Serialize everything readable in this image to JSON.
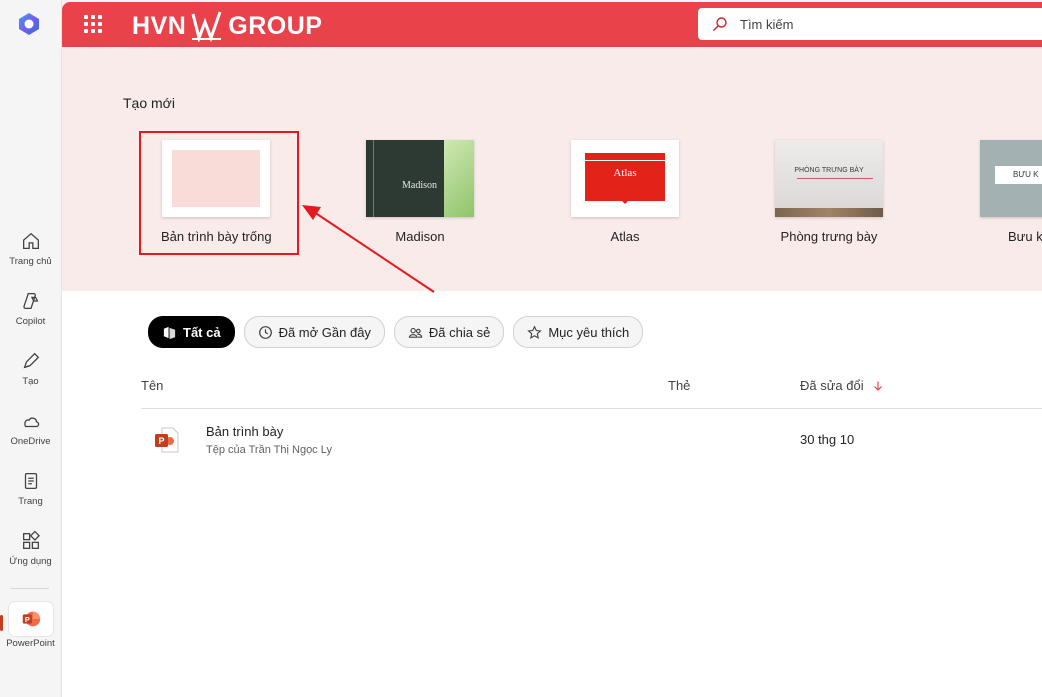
{
  "rail": {
    "items": [
      {
        "label": "Trang chủ",
        "icon": "home-icon"
      },
      {
        "label": "Copilot",
        "icon": "copilot-icon"
      },
      {
        "label": "Tạo",
        "icon": "create-pen-icon"
      },
      {
        "label": "OneDrive",
        "icon": "cloud-icon"
      },
      {
        "label": "Trang",
        "icon": "page-icon"
      },
      {
        "label": "Ứng dụng",
        "icon": "apps-icon"
      }
    ],
    "app": {
      "label": "PowerPoint",
      "icon": "powerpoint-icon"
    }
  },
  "header": {
    "brand_left": "HVN",
    "brand_right": "GROUP",
    "search_placeholder": "Tìm kiếm",
    "color": "#e9424a"
  },
  "create": {
    "title": "Tạo mới",
    "templates": [
      {
        "name": "Bản trình bày trống"
      },
      {
        "name": "Madison",
        "thumb_text": "Madison"
      },
      {
        "name": "Atlas",
        "thumb_text": "Atlas"
      },
      {
        "name": "Phòng trưng bày",
        "thumb_text": "PHÒNG TRƯNG BÀY"
      },
      {
        "name": "Bưu k",
        "thumb_text": "BƯU K"
      }
    ]
  },
  "filters": [
    {
      "label": "Tất cả",
      "icon": "all-files-icon",
      "active": true
    },
    {
      "label": "Đã mở Gần đây",
      "icon": "clock-icon",
      "active": false
    },
    {
      "label": "Đã chia sẻ",
      "icon": "people-icon",
      "active": false
    },
    {
      "label": "Mục yêu thích",
      "icon": "star-icon",
      "active": false
    }
  ],
  "table": {
    "columns": {
      "name": "Tên",
      "tag": "Thẻ",
      "modified": "Đã sửa đổi"
    },
    "sort_icon": "arrow-down-icon",
    "rows": [
      {
        "name": "Bản trình bày",
        "owner": "Tệp của Trần Thị Ngọc Ly",
        "modified": "30 thg 10",
        "icon": "powerpoint-file-icon"
      }
    ]
  }
}
